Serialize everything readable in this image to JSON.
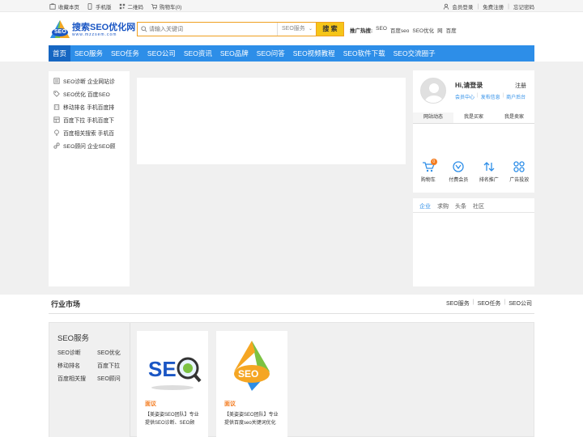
{
  "topbar": {
    "left": [
      {
        "icon": "bookmark-icon",
        "label": "收藏本页"
      },
      {
        "icon": "phone-icon",
        "label": "手机版"
      },
      {
        "icon": "qrcode-icon",
        "label": "二维码"
      },
      {
        "icon": "cart-icon",
        "label": "购物车(0)"
      }
    ],
    "right": [
      {
        "icon": "user-icon",
        "label": "会员登录"
      },
      {
        "label": "免费注册"
      },
      {
        "label": "忘记密码"
      }
    ]
  },
  "logo": {
    "title": "搜索SEO优化网",
    "subtitle": "www.mzzsem.com",
    "badge": "SEO"
  },
  "search": {
    "placeholder": "请输入关键词",
    "category": "SEO服务",
    "button": "搜 索"
  },
  "hot": {
    "label": "推广热搜:",
    "items": [
      "SEO",
      "百度seo",
      "SEO优化",
      "网",
      "百度"
    ]
  },
  "nav": [
    "首页",
    "SEO服务",
    "SEO任务",
    "SEO公司",
    "SEO资讯",
    "SEO品牌",
    "SEO问答",
    "SEO视频教程",
    "SEO软件下载",
    "SEO交流圈子"
  ],
  "side_menu": [
    {
      "icon": "list-icon",
      "label": "SEO诊断 企业网站诊"
    },
    {
      "icon": "tag-icon",
      "label": "SEO优化 百度SEO"
    },
    {
      "icon": "building-icon",
      "label": "移动排名 手机百度排"
    },
    {
      "icon": "grid-icon",
      "label": "百度下拉 手机百度下"
    },
    {
      "icon": "bulb-icon",
      "label": "百度相关搜索 手机百"
    },
    {
      "icon": "link-icon",
      "label": "SEO顾问 企业SEO顾"
    }
  ],
  "user": {
    "greeting": "Hi,请登录",
    "register": "注册",
    "links": [
      "会员中心",
      "发布信息",
      "商户后台"
    ],
    "tabs": [
      "网站动态",
      "我是买家",
      "我是卖家"
    ],
    "quick": [
      {
        "icon": "cart-icon",
        "label": "购物车",
        "badge": "0"
      },
      {
        "icon": "vip-icon",
        "label": "付费会员"
      },
      {
        "icon": "rank-icon",
        "label": "排名推广"
      },
      {
        "icon": "ad-icon",
        "label": "广告投放"
      }
    ]
  },
  "news_tabs": [
    "企业",
    "求购",
    "头条",
    "社区"
  ],
  "market": {
    "title": "行业市场",
    "links": [
      "SEO服务",
      "SEO任务",
      "SEO公司"
    ],
    "category": {
      "name": "SEO服务",
      "items": [
        "SEO诊断",
        "SEO优化",
        "移动排名",
        "百度下拉",
        "百度相关搜",
        "SEO顾问"
      ]
    },
    "cards": [
      {
        "price": "面议",
        "desc": "【美姿姿SEO团队】专业提供SEO诊断、SEO顾"
      },
      {
        "price": "面议",
        "desc": "【美姿姿SEO团队】专业提供百度seo关键词优化"
      }
    ]
  },
  "colors": {
    "nav": "#2d8ee8",
    "nav_active": "#1666c2",
    "search_border": "#f0a020",
    "search_button": "#f5c518",
    "price": "#f47c20",
    "link": "#2d8ee8"
  }
}
